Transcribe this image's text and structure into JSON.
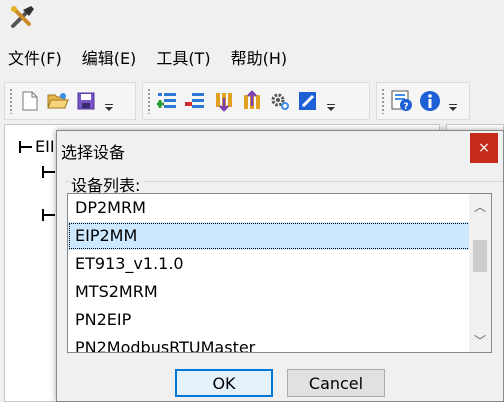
{
  "app": {
    "icon": "tools-icon"
  },
  "menu": {
    "items": [
      {
        "label": "文件(F)"
      },
      {
        "label": "编辑(E)"
      },
      {
        "label": "工具(T)"
      },
      {
        "label": "帮助(H)"
      }
    ]
  },
  "toolbar": {
    "groups": [
      [
        "new-file-icon",
        "open-folder-icon",
        "save-icon"
      ],
      [
        "add-row-icon",
        "remove-row-icon",
        "download-icon",
        "upload-icon",
        "settings-gear-icon",
        "edit-pen-icon"
      ],
      [
        "help-icon",
        "info-icon"
      ]
    ]
  },
  "tree": {
    "root_label": "EII"
  },
  "dialog": {
    "title": "选择设备",
    "close_glyph": "×",
    "group_label": "设备列表:",
    "devices": [
      "DP2MRM",
      "EIP2MM",
      "ET913_v1.1.0",
      "MTS2MRM",
      "PN2EIP",
      "PN2ModbusRTUMaster"
    ],
    "selected_index": 1,
    "scroll_up_glyph": "︿",
    "scroll_down_glyph": "﹀",
    "ok_label": "OK",
    "cancel_label": "Cancel"
  },
  "colors": {
    "close_button": "#c42b1c",
    "selection": "#cce8ff",
    "default_button_border": "#0078d7"
  }
}
